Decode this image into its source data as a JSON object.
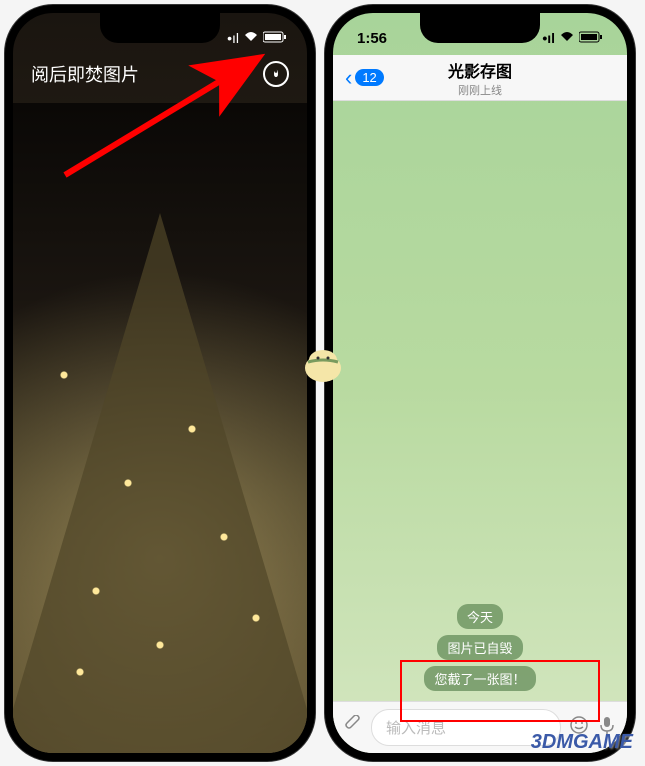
{
  "left_phone": {
    "title": "阅后即焚图片",
    "fire_icon": "fire-icon"
  },
  "right_phone": {
    "status": {
      "time": "1:56"
    },
    "header": {
      "back_unread": "12",
      "title": "光影存图",
      "subtitle": "刚刚上线"
    },
    "messages": {
      "date": "今天",
      "system1": "图片已自毁",
      "system2": "您截了一张图！"
    },
    "input": {
      "placeholder": "输入消息"
    }
  },
  "watermark": "3DMGAME"
}
